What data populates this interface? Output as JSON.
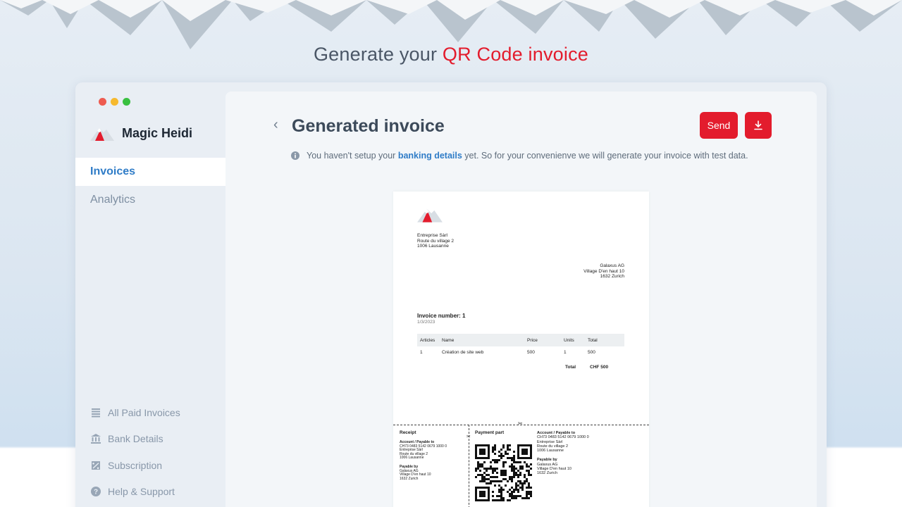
{
  "headline": {
    "prefix": "Generate your ",
    "accent": "QR Code invoice"
  },
  "colors": {
    "accent": "#e31c2d",
    "link": "#2f7cc7",
    "mac_close": "#ee5b50",
    "mac_min": "#f6b92e",
    "mac_max": "#39c040"
  },
  "sidebar": {
    "brand": "Magic Heidi",
    "nav": [
      {
        "label": "Invoices",
        "active": true
      },
      {
        "label": "Analytics",
        "active": false
      }
    ],
    "bottom": [
      {
        "label": "All Paid Invoices",
        "icon": "list-icon"
      },
      {
        "label": "Bank Details",
        "icon": "bank-icon"
      },
      {
        "label": "Subscription",
        "icon": "percent-icon"
      },
      {
        "label": "Help & Support",
        "icon": "help-icon"
      }
    ]
  },
  "main": {
    "back": "‹",
    "title": "Generated invoice",
    "send_label": "Send",
    "info_before": "You haven't setup your ",
    "info_link": "banking details",
    "info_after": " yet. So for your convenienve we will generate your invoice with test data."
  },
  "invoice": {
    "sender": [
      "Entreprise Sàrl",
      "Route du village 2",
      "1006 Lausanne"
    ],
    "recipient": [
      "Galaxus AG",
      "Village D'en haut 10",
      "1632 Zurich"
    ],
    "title": "Invoice number: 1",
    "date": "1/3/2023",
    "columns": [
      "Articles",
      "Name",
      "Price",
      "Units",
      "Total"
    ],
    "rows": [
      [
        "1",
        "Création de site web",
        "500",
        "1",
        "500"
      ]
    ],
    "total_label": "Total",
    "total_value": "CHF 500",
    "receipt": {
      "title": "Receipt",
      "account_label": "Account / Payable to",
      "account": [
        "CH73 0483 5142 0679 1000 0",
        "Entreprise Sàrl",
        "Route du village 2",
        "1006 Lausanne"
      ],
      "payable_label": "Payable by",
      "payable": [
        "Galaxus AG",
        "Village D'en haut 10",
        "1632 Zurich"
      ]
    },
    "payment": {
      "title": "Payment part",
      "account_label": "Account / Payable to",
      "account": [
        "CH73 0483 5142 0679 1000 0",
        "Entreprise Sàrl",
        "Route du village 2",
        "1006 Lausanne"
      ],
      "payable_label": "Payable by",
      "payable": [
        "Galaxus AG",
        "Village D'en haut 10",
        "1632 Zurich"
      ]
    }
  }
}
